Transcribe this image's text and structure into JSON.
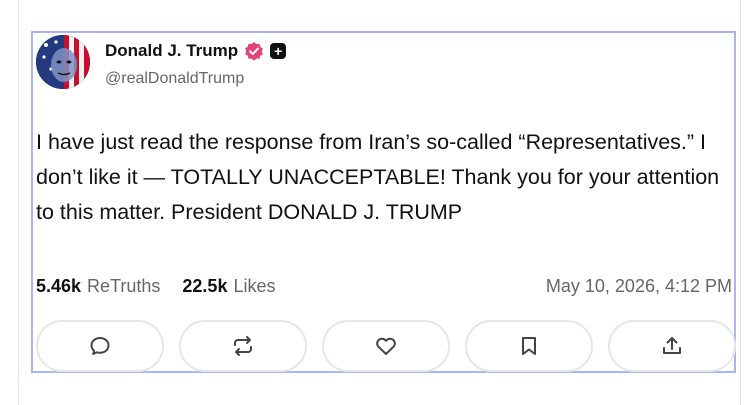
{
  "post": {
    "author_name": "Donald J. Trump",
    "handle": "@realDonaldTrump",
    "verified_icon": "verified-badge-icon",
    "plus_icon": "plus-badge-icon",
    "text": "I have just read the response from Iran’s so-called “Representatives.” I don’t like it — TOTALLY UNACCEPTABLE! Thank you for your attention to this matter. President DONALD J. TRUMP",
    "retruths_count": "5.46k",
    "retruths_label": "ReTruths",
    "likes_count": "22.5k",
    "likes_label": "Likes",
    "timestamp": "May 10, 2026, 4:12 PM"
  },
  "actions": [
    {
      "icon": "reply-icon"
    },
    {
      "icon": "retruth-icon"
    },
    {
      "icon": "like-icon"
    },
    {
      "icon": "bookmark-icon"
    },
    {
      "icon": "share-icon"
    }
  ],
  "colors": {
    "card_border": "#a9b6f5",
    "verified_badge": "#e0447a",
    "muted_text": "#666666",
    "icon_stroke": "#444444"
  }
}
